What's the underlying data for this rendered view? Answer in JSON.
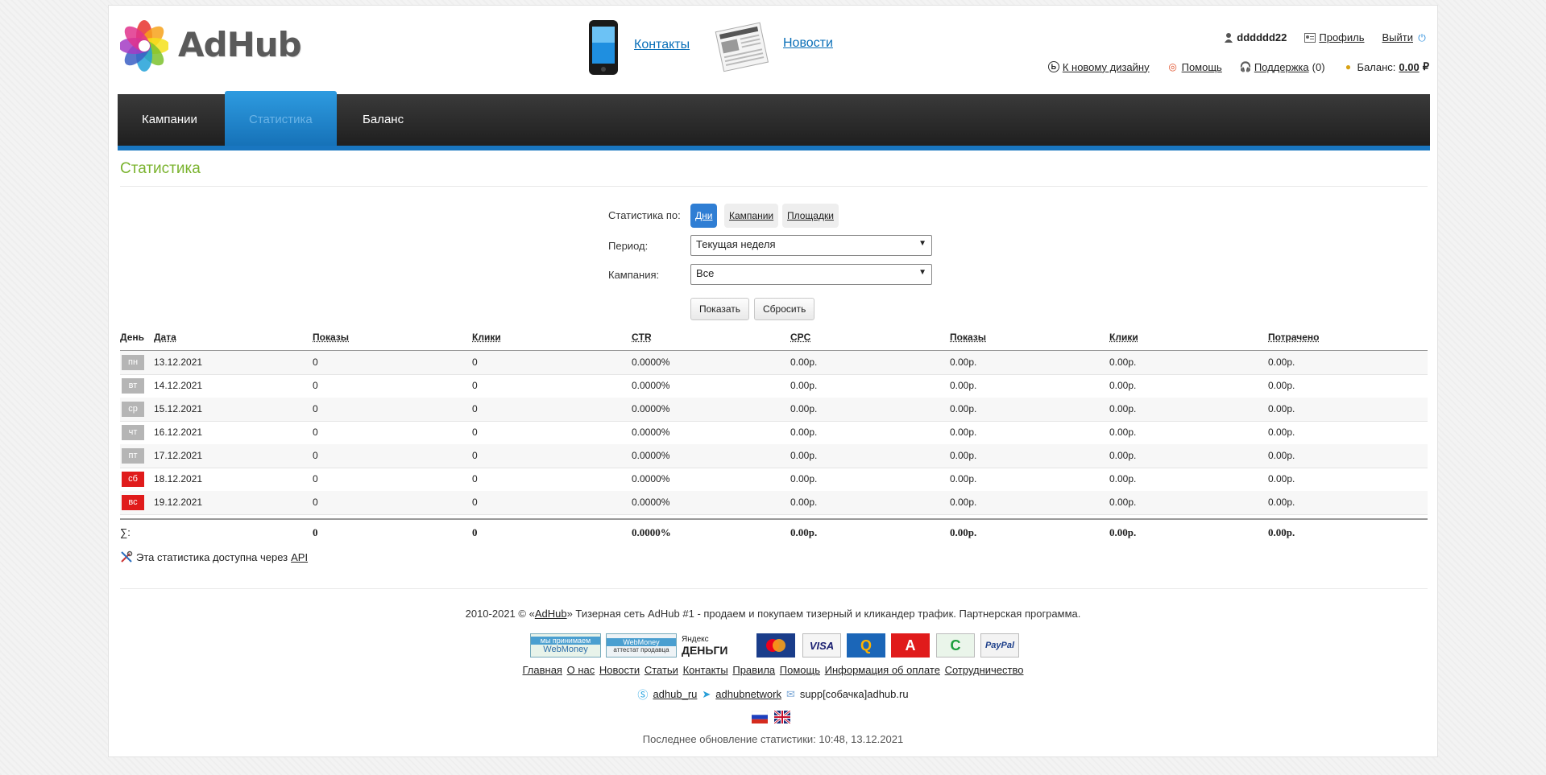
{
  "header": {
    "logo_text": "AdHub",
    "contacts": "Контакты",
    "news": "Новости",
    "username": "dddddd22",
    "profile": "Профиль",
    "logout": "Выйти",
    "new_design": "К новому дизайну",
    "help": "Помощь",
    "support": "Поддержка",
    "support_count": "(0)",
    "balance_label": "Баланс:",
    "balance_value": "0.00",
    "currency": "₽"
  },
  "nav": {
    "items": [
      "Кампании",
      "Статистика",
      "Баланс"
    ],
    "active": "Статистика"
  },
  "page_title": "Статистика",
  "filters": {
    "stats_by_label": "Статистика по:",
    "tabs": [
      "Дни",
      "Кампании",
      "Площадки"
    ],
    "period_label": "Период:",
    "period_value": "Текущая неделя",
    "campaign_label": "Кампания:",
    "campaign_value": "Все",
    "show_button": "Показать",
    "reset_button": "Сбросить"
  },
  "table": {
    "columns": [
      "День",
      "Дата",
      "Показы",
      "Клики",
      "CTR",
      "CPC",
      "Показы",
      "Клики",
      "Потрачено"
    ],
    "rows": [
      {
        "day": "пн",
        "weekend": false,
        "date": "13.12.2021",
        "shows": "0",
        "clicks": "0",
        "ctr": "0.0000%",
        "cpc": "0.00р.",
        "shows_cost": "0.00р.",
        "clicks_cost": "0.00р.",
        "spent": "0.00р."
      },
      {
        "day": "вт",
        "weekend": false,
        "date": "14.12.2021",
        "shows": "0",
        "clicks": "0",
        "ctr": "0.0000%",
        "cpc": "0.00р.",
        "shows_cost": "0.00р.",
        "clicks_cost": "0.00р.",
        "spent": "0.00р."
      },
      {
        "day": "ср",
        "weekend": false,
        "date": "15.12.2021",
        "shows": "0",
        "clicks": "0",
        "ctr": "0.0000%",
        "cpc": "0.00р.",
        "shows_cost": "0.00р.",
        "clicks_cost": "0.00р.",
        "spent": "0.00р."
      },
      {
        "day": "чт",
        "weekend": false,
        "date": "16.12.2021",
        "shows": "0",
        "clicks": "0",
        "ctr": "0.0000%",
        "cpc": "0.00р.",
        "shows_cost": "0.00р.",
        "clicks_cost": "0.00р.",
        "spent": "0.00р."
      },
      {
        "day": "пт",
        "weekend": false,
        "date": "17.12.2021",
        "shows": "0",
        "clicks": "0",
        "ctr": "0.0000%",
        "cpc": "0.00р.",
        "shows_cost": "0.00р.",
        "clicks_cost": "0.00р.",
        "spent": "0.00р."
      },
      {
        "day": "сб",
        "weekend": true,
        "date": "18.12.2021",
        "shows": "0",
        "clicks": "0",
        "ctr": "0.0000%",
        "cpc": "0.00р.",
        "shows_cost": "0.00р.",
        "clicks_cost": "0.00р.",
        "spent": "0.00р."
      },
      {
        "day": "вс",
        "weekend": true,
        "date": "19.12.2021",
        "shows": "0",
        "clicks": "0",
        "ctr": "0.0000%",
        "cpc": "0.00р.",
        "shows_cost": "0.00р.",
        "clicks_cost": "0.00р.",
        "spent": "0.00р."
      }
    ],
    "totals": {
      "label": "∑:",
      "shows": "0",
      "clicks": "0",
      "ctr": "0.0000%",
      "cpc": "0.00р.",
      "shows_cost": "0.00р.",
      "clicks_cost": "0.00р.",
      "spent": "0.00р."
    }
  },
  "api_note": {
    "text": "Эта статистика доступна через",
    "link": "API"
  },
  "footer": {
    "copyright_prefix": "2010-2021 © «",
    "brand": "AdHub",
    "copyright_suffix": "» Тизерная сеть AdHub #1 - продаем и покупаем тизерный и кликандер трафик. Партнерская программа.",
    "payments": {
      "wm_top": "мы принимаем",
      "wm_bottom": "WebMoney",
      "wma_top": "WebMoney",
      "wma_bottom": "аттестат продавца",
      "yandex_top": "Яндекс",
      "yandex_bottom": "ДЕНЬГИ",
      "mastercard": "MasterCard",
      "visa": "VISA",
      "qiwi": "Q",
      "alfa": "А",
      "sber": "С",
      "paypal": "PayPal"
    },
    "links": [
      "Главная",
      "О нас",
      "Новости",
      "Статьи",
      "Контакты",
      "Правила",
      "Помощь",
      "Информация об оплате",
      "Сотрудничество"
    ],
    "skype": "adhub_ru",
    "telegram": "adhubnetwork",
    "email": "supp[собачка]adhub.ru",
    "last_update": "Последнее обновление статистики: 10:48, 13.12.2021"
  },
  "colors": {
    "accent_blue": "#1976c0",
    "title_green": "#7ab32e",
    "weekend_red": "#e01b1b",
    "weekday_gray": "#b5b5b5"
  }
}
